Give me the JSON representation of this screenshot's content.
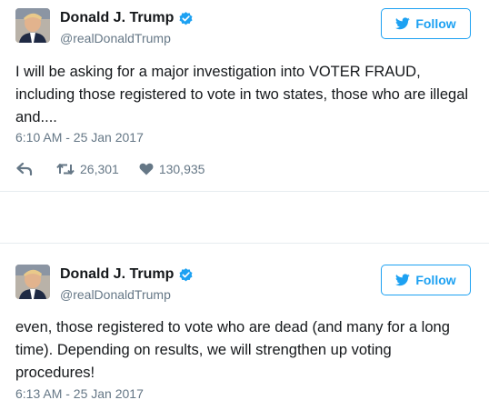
{
  "tweets": [
    {
      "display_name": "Donald J. Trump",
      "handle": "@realDonaldTrump",
      "follow_label": "Follow",
      "text": "I will be asking for a major investigation into VOTER FRAUD, including those registered to vote in two states, those who are illegal and....",
      "timestamp": "6:10 AM - 25 Jan 2017",
      "retweets": "26,301",
      "likes": "130,935"
    },
    {
      "display_name": "Donald J. Trump",
      "handle": "@realDonaldTrump",
      "follow_label": "Follow",
      "text": "even, those registered to vote who are dead (and many for a long time). Depending on results, we will strengthen up voting procedures!",
      "timestamp": "6:13 AM - 25 Jan 2017"
    }
  ],
  "icons": {
    "verified": "verified-badge-icon",
    "follow": "twitter-bird-icon",
    "reply": "reply-arrow-icon",
    "retweet": "retweet-icon",
    "like": "heart-icon"
  },
  "colors": {
    "accent": "#1da1f2",
    "text": "#14171a",
    "secondary_text": "#657786",
    "divider": "#e6ecf0"
  }
}
